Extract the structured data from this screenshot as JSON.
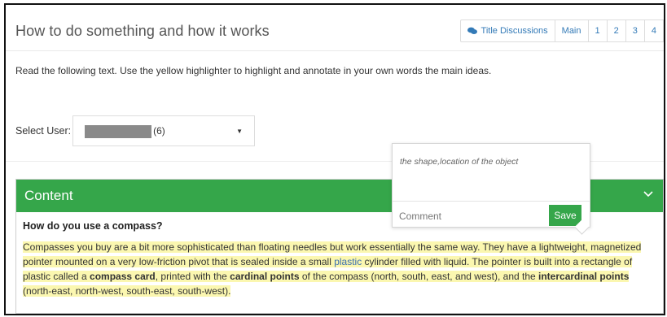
{
  "header": {
    "title": "How to do something and how it works",
    "nav": {
      "discussions": "Title Discussions",
      "main": "Main",
      "pages": [
        "1",
        "2",
        "3",
        "4"
      ]
    }
  },
  "instructions": "Read the following text. Use the yellow highlighter to highlight and annotate in your own words the main ideas.",
  "select_user": {
    "label": "Select User:",
    "count": "(6)",
    "caret": "▼"
  },
  "content": {
    "header": "Content",
    "heading": "How do you use a compass?",
    "paragraph": {
      "p1": "Compasses you buy are a bit more sophisticated than floating needles but work essentially the same way. They have a lightweight, magnetized pointer mounted on a very low-friction pivot that is sealed inside a small ",
      "link": "plastic",
      "p2": " cylinder filled with liquid. The pointer is built into a rectangle of plastic called a ",
      "b1": "compass card",
      "p3": ", printed with the ",
      "b2": "cardinal points",
      "p4": " of the compass (north, south, east, and west), and the ",
      "b3": "intercardinal points",
      "p5": " (north-east, north-west, south-east, south-west)."
    }
  },
  "annotation": {
    "text": "the shape,location of the object",
    "comment_placeholder": "Comment",
    "save_label": "Save"
  },
  "colors": {
    "accent_green": "#35a64a",
    "highlight_yellow": "#fbf7b0",
    "link_blue": "#337ab7"
  }
}
